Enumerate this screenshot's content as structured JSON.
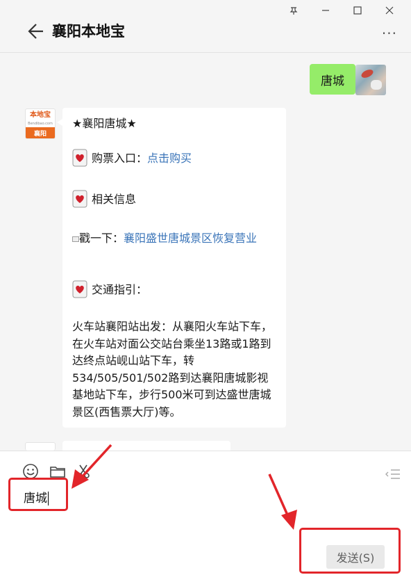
{
  "window": {
    "controls": [
      "pin",
      "minimize",
      "maximize",
      "close"
    ]
  },
  "header": {
    "title": "襄阳本地宝",
    "back_icon": "arrow-left-icon",
    "more_label": "···"
  },
  "chat": {
    "sent_message": "唐城",
    "bot_avatar": {
      "brand_text": "本地宝",
      "url_text": "Bendibao.com",
      "city_text": "襄阳"
    },
    "bot_message": {
      "title": "★襄阳唐城★",
      "ticket_label": "购票入口：",
      "ticket_link": "点击购买",
      "info_label": "相关信息",
      "poke_label": "戳一下：",
      "poke_link": "襄阳盛世唐城景区恢复营业",
      "traffic_label": "交通指引：",
      "traffic_text": "火车站襄阳站出发：从襄阳火车站下车，在火车站对面公交站台乘坐13路或1路到达终点站岘山站下车，转534/505/501/502路到达襄阳唐城影视基地站下车，步行500米可到达盛世唐城景区(西售票大厅)等。"
    }
  },
  "input": {
    "tools": [
      "emoji-icon",
      "folder-icon",
      "scissors-icon",
      "collapse-icon"
    ],
    "typed_text": "唐城",
    "send_label": "发送(S)"
  },
  "colors": {
    "sent_bubble": "#95ec69",
    "link": "#3a74b8",
    "annotation": "#e2252a",
    "brand_orange": "#ea6a1f"
  }
}
